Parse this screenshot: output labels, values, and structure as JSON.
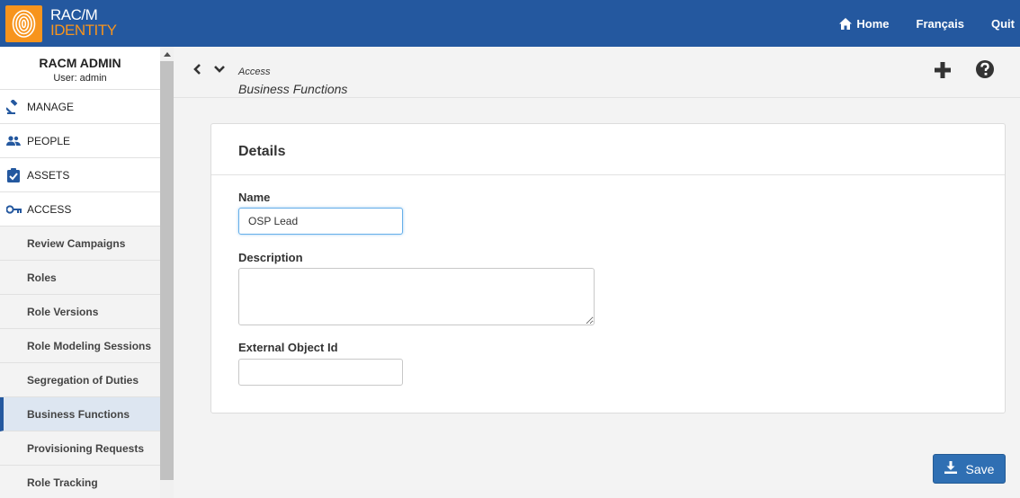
{
  "app": {
    "logo_line1": "RAC/M",
    "logo_line2": "IDENTITY",
    "colors": {
      "topbar": "#24589f",
      "accent": "#f7941d",
      "primary_button": "#2f6fb3"
    }
  },
  "topnav": {
    "home": {
      "label": "Home",
      "icon": "home-icon"
    },
    "language": "Français",
    "quit": "Quit"
  },
  "sidebar": {
    "user_title": "RACM ADMIN",
    "user_sub": "User: admin",
    "sections": [
      {
        "label": "MANAGE",
        "icon": "gavel-icon"
      },
      {
        "label": "PEOPLE",
        "icon": "people-icon"
      },
      {
        "label": "ASSETS",
        "icon": "clipboard-check-icon"
      },
      {
        "label": "ACCESS",
        "icon": "key-icon"
      }
    ],
    "access_items": [
      "Review Campaigns",
      "Roles",
      "Role Versions",
      "Role Modeling Sessions",
      "Segregation of Duties",
      "Business Functions",
      "Provisioning Requests",
      "Role Tracking"
    ],
    "active_item": "Business Functions"
  },
  "breadcrumb": {
    "parent": "Access",
    "current": "Business Functions"
  },
  "details": {
    "title": "Details",
    "name_label": "Name",
    "name_value": "OSP Lead",
    "description_label": "Description",
    "description_value": "",
    "external_id_label": "External Object Id",
    "external_id_value": ""
  },
  "actions": {
    "save_label": "Save"
  }
}
